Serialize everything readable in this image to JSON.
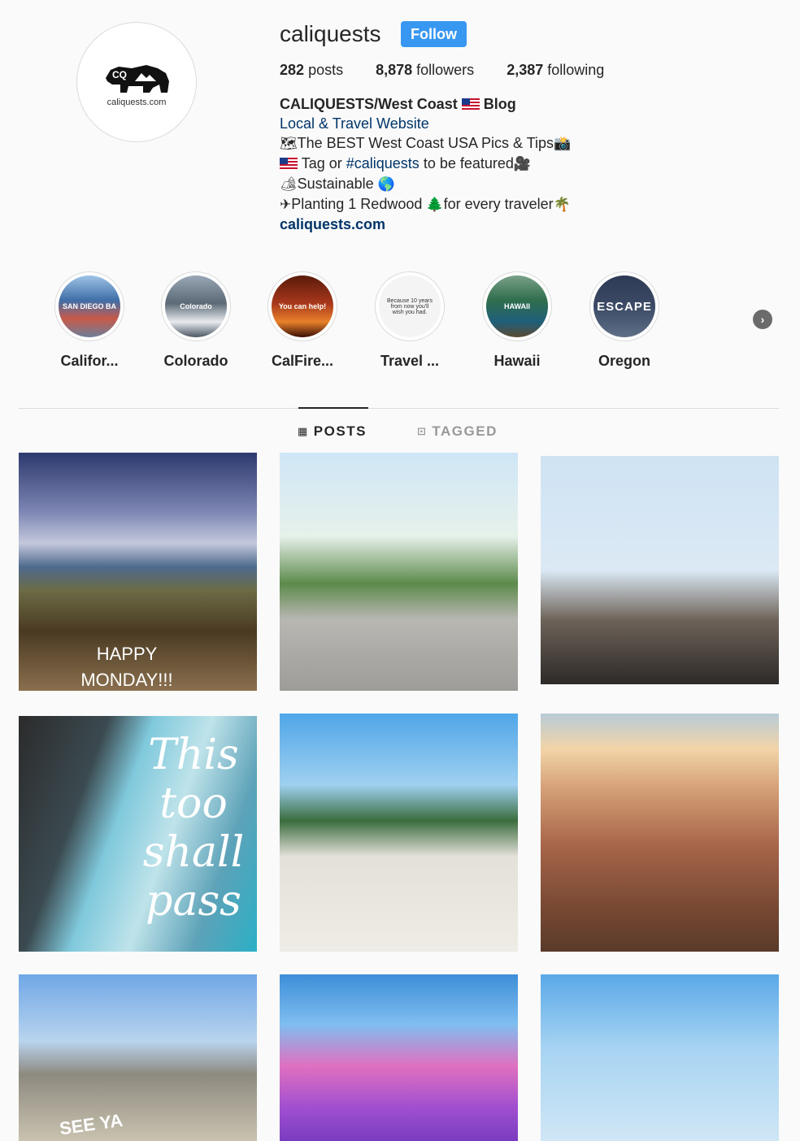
{
  "profile": {
    "username": "caliquests",
    "follow_label": "Follow",
    "avatar_caption": "caliquests.com",
    "avatar_logo": "CQ"
  },
  "stats": {
    "posts_count": "282",
    "posts_label": "posts",
    "followers_count": "8,878",
    "followers_label": "followers",
    "following_count": "2,387",
    "following_label": "following"
  },
  "bio": {
    "name_a": "CALIQUESTS/West Coast",
    "name_b": "Blog",
    "category": "Local & Travel Website",
    "line1": "The BEST West Coast USA Pics & Tips",
    "line2_a": "Tag or",
    "line2_tag": "#caliquests",
    "line2_b": "to be featured",
    "line3": "Sustainable",
    "line4_a": "Planting 1 Redwood",
    "line4_b": "for every traveler",
    "link": "caliquests.com"
  },
  "highlights": [
    {
      "label": "Califor...",
      "thumb_text": "SAN DIEGO BA",
      "color": "#3f6fa8"
    },
    {
      "label": "Colorado",
      "thumb_text": "Colorado",
      "color": "#6a7d8e"
    },
    {
      "label": "CalFire...",
      "thumb_text": "You can help!",
      "color": "#a8381c"
    },
    {
      "label": "Travel ...",
      "thumb_text": "Because 10 years from now you'll wish you had.",
      "color": "#f2f2f2"
    },
    {
      "label": "Hawaii",
      "thumb_text": "HAWAII",
      "color": "#2f6e4c"
    },
    {
      "label": "Oregon",
      "thumb_text": "ESCAPE",
      "color": "#3c4a66"
    }
  ],
  "tabs": {
    "posts": "POSTS",
    "tagged": "TAGGED"
  },
  "posts": {
    "p1_text_a": "HAPPY",
    "p1_text_b": "MONDAY!!!",
    "p4_text": [
      "This",
      "too",
      "shall",
      "pass"
    ],
    "p7_text": "SEE YA"
  },
  "colors": {
    "follow_button": "#3897f0",
    "link_blue": "#003569",
    "background": "#fafafa"
  }
}
